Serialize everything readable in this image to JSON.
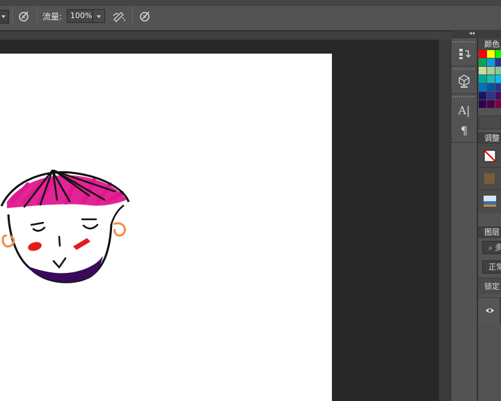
{
  "options_bar": {
    "flow_label": "流量:",
    "flow_value": "100%"
  },
  "panels": {
    "color_tab": "颜色",
    "adjustments_tab": "调整",
    "layers_tab": "图层",
    "layers_search_text": "多",
    "blend_mode": "正常",
    "lock_label": "锁定"
  },
  "swatches": [
    [
      "#ff0000",
      "#ffff00",
      "#00ff00"
    ],
    [
      "#00a651",
      "#0a9de3",
      "#2e3192"
    ],
    [
      "#c4df9b",
      "#a3d39c",
      "#82ca9d"
    ],
    [
      "#00a99d",
      "#1cbbb4",
      "#00bff3"
    ],
    [
      "#0072bc",
      "#0054a6",
      "#2e3192"
    ],
    [
      "#1b1464",
      "#2e3192",
      "#440e62"
    ],
    [
      "#32004b",
      "#4b0049",
      "#7b0046"
    ]
  ],
  "icons": [
    "airbrush-icon",
    "brush-pressure-icon",
    "tablet-pressure-icon",
    "history-icon",
    "3d-icon",
    "character-icon",
    "paragraph-icon",
    "eye-icon",
    "search-icon"
  ]
}
